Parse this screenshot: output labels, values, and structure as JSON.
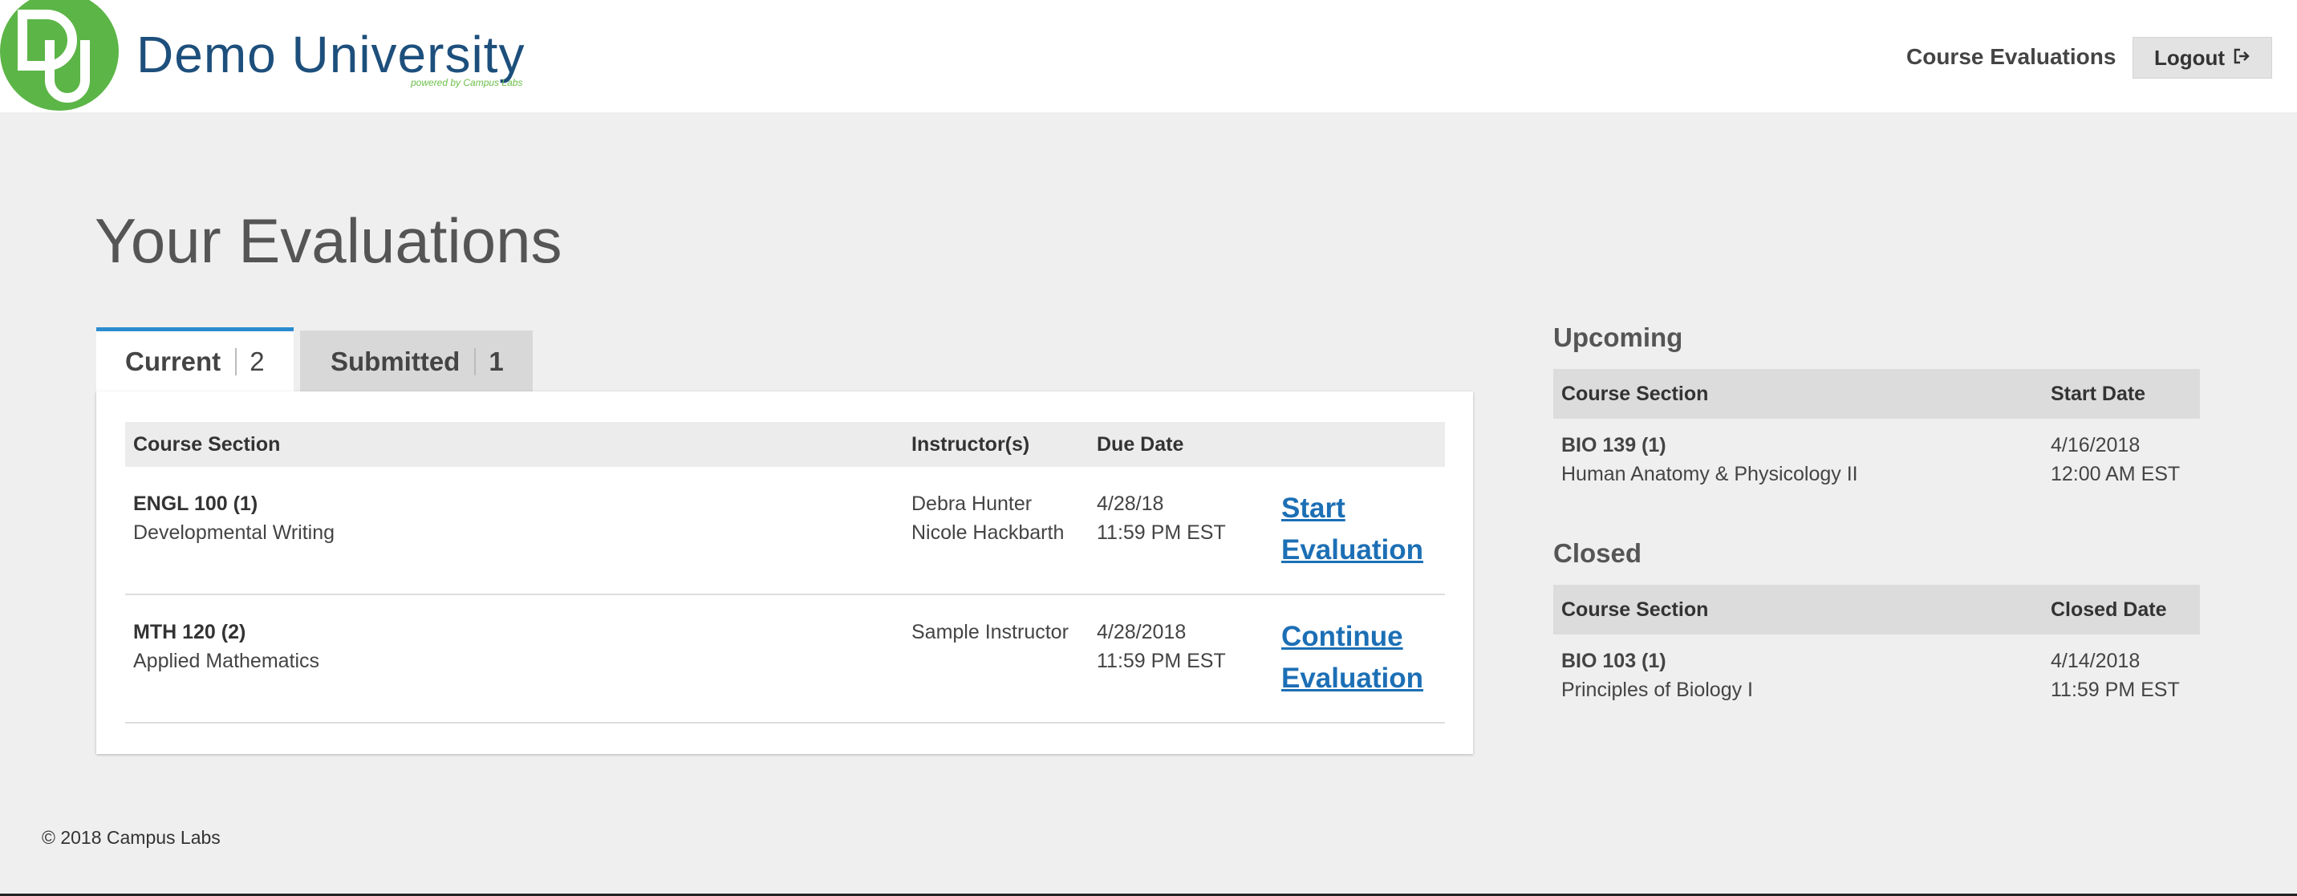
{
  "header": {
    "brand_name": "Demo University",
    "brand_tagline": "powered by Campus Labs",
    "logo_icon": "du-logo",
    "nav_link": "Course Evaluations",
    "logout_label": "Logout",
    "logout_icon": "sign-out-icon"
  },
  "page": {
    "title": "Your Evaluations"
  },
  "tabs": [
    {
      "label": "Current",
      "count": "2",
      "active": true
    },
    {
      "label": "Submitted",
      "count": "1",
      "active": false
    }
  ],
  "current_table": {
    "headers": {
      "course": "Course Section",
      "instructors": "Instructor(s)",
      "due": "Due Date"
    },
    "rows": [
      {
        "course_code": "ENGL 100 (1)",
        "course_name": "Developmental Writing",
        "instructor_1": "Debra Hunter",
        "instructor_2": "Nicole Hackbarth",
        "due_date": "4/28/18",
        "due_time": "11:59 PM EST",
        "action_line1": "Start",
        "action_line2": "Evaluation"
      },
      {
        "course_code": "MTH 120 (2)",
        "course_name": "Applied Mathematics",
        "instructor_1": "Sample Instructor",
        "instructor_2": "",
        "due_date": "4/28/2018",
        "due_time": "11:59 PM EST",
        "action_line1": "Continue",
        "action_line2": "Evaluation"
      }
    ]
  },
  "upcoming": {
    "heading": "Upcoming",
    "headers": {
      "course": "Course Section",
      "date": "Start Date"
    },
    "rows": [
      {
        "course_code": "BIO 139 (1)",
        "course_name": "Human Anatomy & Physicology II",
        "date": "4/16/2018",
        "time": "12:00 AM EST"
      }
    ]
  },
  "closed": {
    "heading": "Closed",
    "headers": {
      "course": "Course Section",
      "date": "Closed Date"
    },
    "rows": [
      {
        "course_code": "BIO 103 (1)",
        "course_name": "Principles of Biology I",
        "date": "4/14/2018",
        "time": "11:59 PM EST"
      }
    ]
  },
  "footer": {
    "copyright": "© 2018 Campus Labs"
  },
  "colors": {
    "brand_green": "#5cb547",
    "brand_blue": "#1d4f7c",
    "link_blue": "#1c6fb5",
    "tab_accent": "#2a8ccf",
    "page_bg": "#efefef"
  }
}
